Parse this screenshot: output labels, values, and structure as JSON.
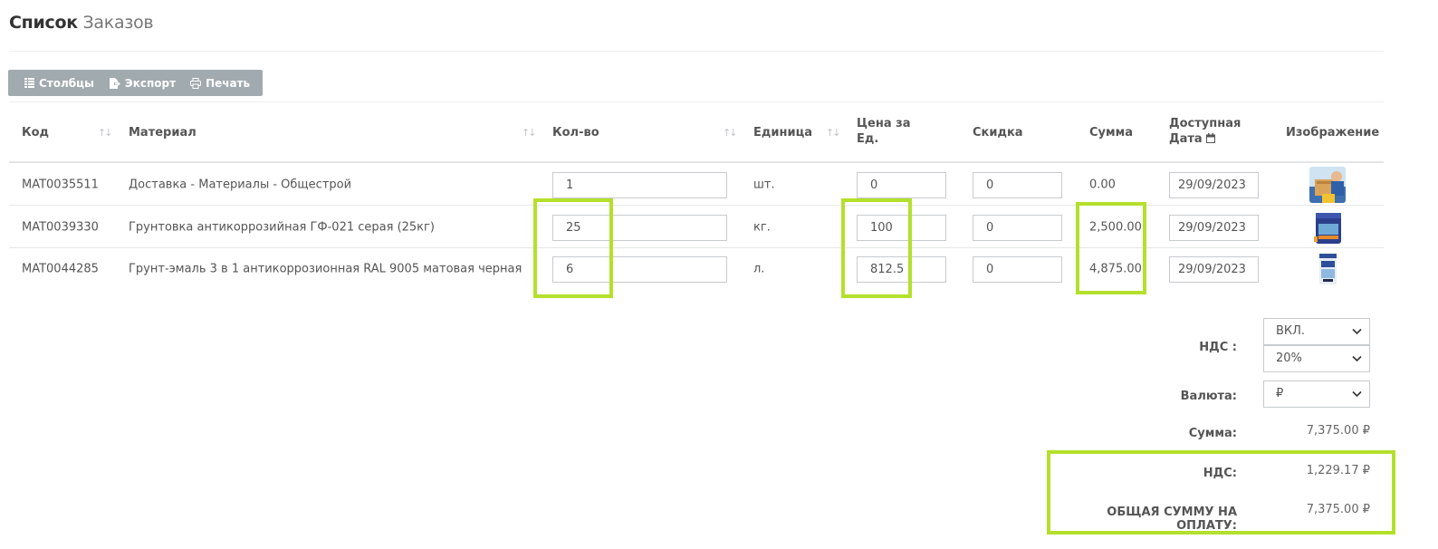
{
  "page": {
    "title_bold": "Список",
    "title_light": "Заказов"
  },
  "toolbar": {
    "columns": "Столбцы",
    "export": "Экспорт",
    "print": "Печать"
  },
  "table": {
    "headers": {
      "code": "Код",
      "material": "Материал",
      "qty": "Кол-во",
      "unit": "Единица",
      "price_l1": "Цена за",
      "price_l2": "Ед.",
      "discount": "Скидка",
      "sum": "Сумма",
      "date_l1": "Доступная",
      "date_l2": "Дата",
      "image": "Изображение"
    },
    "rows": [
      {
        "code": "MAT0035511",
        "material": "Доставка - Материалы - Общестрой",
        "qty": "1",
        "unit": "шт.",
        "price": "0",
        "discount": "0",
        "sum": "0.00",
        "date": "29/09/2023"
      },
      {
        "code": "MAT0039330",
        "material": "Грунтовка антикоррозийная ГФ-021 серая (25кг)",
        "qty": "25",
        "unit": "кг.",
        "price": "100",
        "discount": "0",
        "sum": "2,500.00",
        "date": "29/09/2023"
      },
      {
        "code": "MAT0044285",
        "material": "Грунт-эмаль 3 в 1 антикоррозионная RAL 9005 матовая черная",
        "qty": "6",
        "unit": "л.",
        "price": "812.5",
        "discount": "0",
        "sum": "4,875.00",
        "date": "29/09/2023"
      }
    ]
  },
  "summary": {
    "vat_label": "НДС :",
    "vat_mode": "ВКЛ.",
    "vat_rate": "20%",
    "currency_label": "Валюта:",
    "currency": "₽",
    "sum_label": "Сумма:",
    "sum_value": "7,375.00 ₽",
    "vat_amount_label": "НДС:",
    "vat_amount_value": "1,229.17 ₽",
    "total_label": "ОБЩАЯ СУММУ НА ОПЛАТУ:",
    "total_value": "7,375.00 ₽"
  },
  "colors": {
    "highlight": "#b4e02c",
    "toolbar": "#a1aaae"
  },
  "icons": [
    "columns-icon",
    "export-icon",
    "print-icon",
    "calendar-icon",
    "sort-icon",
    "chevron-down-icon"
  ]
}
